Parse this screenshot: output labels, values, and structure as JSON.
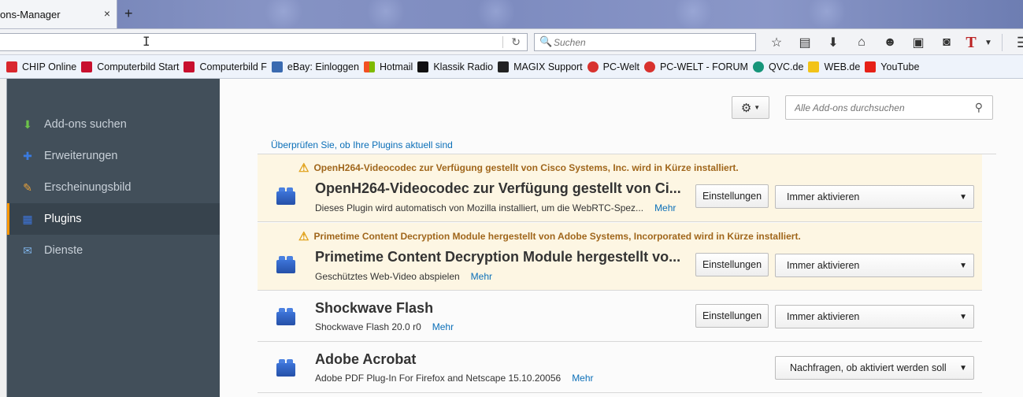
{
  "tab": {
    "title": "ons-Manager",
    "close": "×",
    "new_tab": "+"
  },
  "navbar": {
    "reload": "↻",
    "search_placeholder": "Suchen",
    "search_icon": "🔍",
    "icons": [
      "star-icon",
      "reading-list-icon",
      "download-icon",
      "home-icon",
      "chat-icon",
      "screenshot-icon",
      "robot-icon"
    ]
  },
  "bookmarks": [
    {
      "label": "CHIP Online",
      "color": "#d9272e"
    },
    {
      "label": "Computerbild Start",
      "color": "#c8102e"
    },
    {
      "label": "Computerbild F",
      "color": "#c8102e"
    },
    {
      "label": "eBay: Einloggen",
      "color": "#3a6ab0"
    },
    {
      "label": "Hotmail",
      "color": "#f25022"
    },
    {
      "label": "Klassik Radio",
      "color": "#111111"
    },
    {
      "label": "MAGIX Support",
      "color": "#222222"
    },
    {
      "label": "PC-Welt",
      "color": "#d8322e"
    },
    {
      "label": "PC-WELT - FORUM",
      "color": "#d8322e"
    },
    {
      "label": "QVC.de",
      "color": "#16957a"
    },
    {
      "label": "WEB.de",
      "color": "#f2c318"
    },
    {
      "label": "YouTube",
      "color": "#e62117"
    }
  ],
  "sidebar": {
    "items": [
      {
        "label": "Add-ons suchen",
        "icon": "get-addons-icon",
        "glyph": "⬇",
        "color": "#6cc24a"
      },
      {
        "label": "Erweiterungen",
        "icon": "extensions-icon",
        "glyph": "✚",
        "color": "#3a7be0"
      },
      {
        "label": "Erscheinungsbild",
        "icon": "appearance-icon",
        "glyph": "🎨",
        "color": "#e8a23a"
      },
      {
        "label": "Plugins",
        "icon": "plugins-icon",
        "glyph": "▦",
        "color": "#3d74d8"
      },
      {
        "label": "Dienste",
        "icon": "services-icon",
        "glyph": "💬",
        "color": "#7fb3e8"
      }
    ],
    "selected": "Plugins"
  },
  "main": {
    "search_placeholder": "Alle Add-ons durchsuchen",
    "check_link": "Überprüfen Sie, ob Ihre Plugins aktuell sind",
    "plugins": [
      {
        "warning": "OpenH264-Videocodec zur Verfügung gestellt von Cisco Systems, Inc. wird in Kürze installiert.",
        "name": "OpenH264-Videocodec zur Verfügung gestellt von Ci...",
        "desc": "Dieses Plugin wird automatisch von Mozilla installiert, um die WebRTC-Spez...",
        "more": "Mehr",
        "settings": "Einstellungen",
        "activation": "Immer aktivieren"
      },
      {
        "warning": "Primetime Content Decryption Module hergestellt von Adobe Systems, Incorporated wird in Kürze installiert.",
        "name": "Primetime Content Decryption Module hergestellt vo...",
        "desc": "Geschütztes Web-Video abspielen",
        "more": "Mehr",
        "settings": "Einstellungen",
        "activation": "Immer aktivieren"
      },
      {
        "name": "Shockwave Flash",
        "desc": "Shockwave Flash 20.0 r0",
        "more": "Mehr",
        "settings": "Einstellungen",
        "activation": "Immer aktivieren"
      },
      {
        "name": "Adobe Acrobat",
        "desc": "Adobe PDF Plug-In For Firefox and Netscape 15.10.20056",
        "more": "Mehr",
        "activation": "Nachfragen, ob aktiviert werden soll"
      }
    ]
  }
}
